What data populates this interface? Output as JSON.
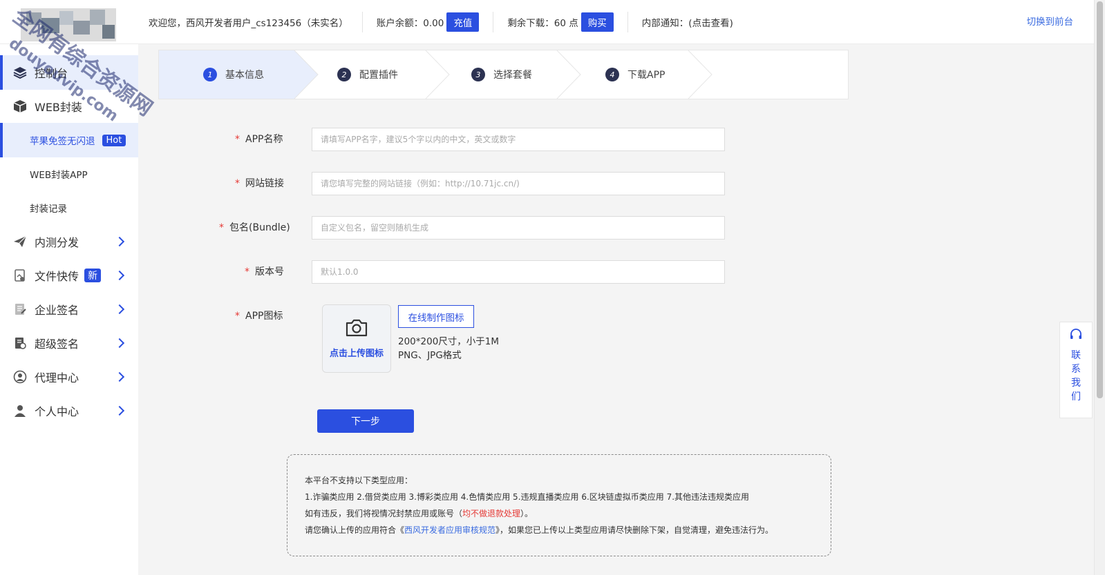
{
  "header": {
    "welcome": "欢迎您，西风开发者用户_cs123456（未实名）",
    "balance_label": "账户余额：0.00",
    "recharge_label": "充值",
    "downloads_label": "剩余下载：60 点",
    "buy_label": "购买",
    "notice_label": "内部通知：(点击查看)",
    "switch_front": "切换到前台"
  },
  "sidebar": {
    "items": [
      {
        "label": "控制台",
        "icon": "layers-icon"
      },
      {
        "label": "WEB封装",
        "icon": "box-icon"
      },
      {
        "label": "苹果免签无闪退",
        "badge": "Hot"
      },
      {
        "label": "WEB封装APP"
      },
      {
        "label": "封装记录"
      },
      {
        "label": "内测分发",
        "icon": "paper-plane-icon"
      },
      {
        "label": "文件快传",
        "icon": "file-share-icon",
        "badge": "新"
      },
      {
        "label": "企业签名",
        "icon": "document-sign-icon"
      },
      {
        "label": "超级签名",
        "icon": "certificate-icon"
      },
      {
        "label": "代理中心",
        "icon": "agent-icon"
      },
      {
        "label": "个人中心",
        "icon": "user-icon"
      }
    ]
  },
  "steps": [
    {
      "num": "1",
      "label": "基本信息"
    },
    {
      "num": "2",
      "label": "配置插件"
    },
    {
      "num": "3",
      "label": "选择套餐"
    },
    {
      "num": "4",
      "label": "下载APP"
    }
  ],
  "form": {
    "required_mark": "*",
    "app_name": {
      "label": "APP名称",
      "placeholder": "请填写APP名字，建议5个字以内的中文，英文或数字"
    },
    "site_url": {
      "label": "网站链接",
      "placeholder": "请您填写完整的网站链接（例如：http://10.71jc.cn/)"
    },
    "bundle": {
      "label": "包名(Bundle)",
      "placeholder": "自定义包名，留空则随机生成"
    },
    "version": {
      "label": "版本号",
      "placeholder": "默认1.0.0"
    },
    "icon": {
      "label": "APP图标",
      "upload_text": "点击上传图标",
      "make_online": "在线制作图标",
      "hint_size": "200*200尺寸，小于1M",
      "hint_format": "PNG、JPG格式"
    },
    "next_label": "下一步"
  },
  "notice": {
    "line1": "本平台不支持以下类型应用：",
    "line2": "1.诈骗类应用 2.借贷类应用 3.博彩类应用 4.色情类应用 5.违规直播类应用 6.区块链虚拟币类应用 7.其他违法违规类应用",
    "line3_pre": "如有违反，我们将视情况封禁应用或账号（",
    "line3_red": "均不做退款处理",
    "line3_post": "）。",
    "line4_pre": "请您确认上传的应用符合《",
    "line4_link": "西风开发者应用审核规范",
    "line4_post": "》，如果您已上传以上类型应用请尽快删除下架，自觉清理，避免违法行为。"
  },
  "contact": {
    "chars": [
      "联",
      "系",
      "我",
      "们"
    ],
    "icon": "headset-icon"
  },
  "watermark": {
    "line1": "全网有综合资源网",
    "line2": "douyouvip.com"
  },
  "colors": {
    "accent": "#2b4fe0",
    "danger": "#e53935",
    "link": "#3a6be0"
  }
}
